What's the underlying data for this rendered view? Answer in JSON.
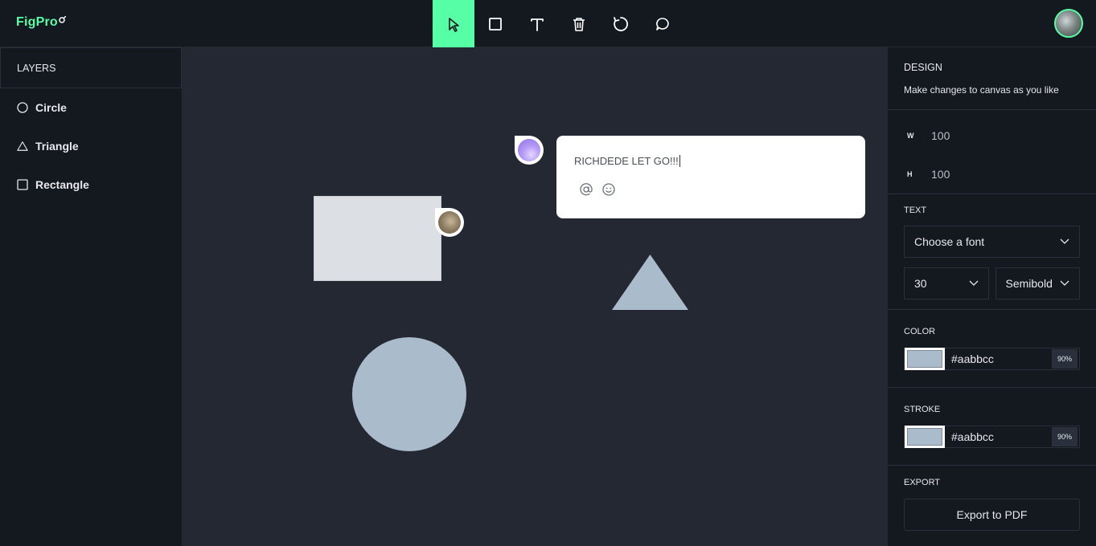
{
  "app": {
    "logo_text": "FigPro",
    "accent_color": "#56ffa6"
  },
  "toolbar": {
    "tools": [
      {
        "name": "select",
        "icon": "cursor-icon",
        "active": true
      },
      {
        "name": "rectangle",
        "icon": "square-icon"
      },
      {
        "name": "text",
        "icon": "text-icon"
      },
      {
        "name": "delete",
        "icon": "trash-icon"
      },
      {
        "name": "reset",
        "icon": "reset-icon"
      },
      {
        "name": "comment",
        "icon": "comment-icon"
      }
    ]
  },
  "layers": {
    "title": "LAYERS",
    "items": [
      {
        "label": "Circle",
        "icon": "circle-icon"
      },
      {
        "label": "Triangle",
        "icon": "triangle-icon"
      },
      {
        "label": "Rectangle",
        "icon": "square-icon"
      }
    ]
  },
  "canvas": {
    "comment": {
      "text": "RICHDEDE LET GO!!!"
    },
    "shape_fill": "#aabbcc",
    "rect_fill": "#dcdfe4"
  },
  "design": {
    "title": "DESIGN",
    "subtitle": "Make changes to canvas as you like",
    "width_label": "W",
    "width_value": "100",
    "height_label": "H",
    "height_value": "100"
  },
  "text": {
    "title": "TEXT",
    "font_placeholder": "Choose a font",
    "font_size": "30",
    "font_weight": "Semibold"
  },
  "color": {
    "title": "COLOR",
    "hex": "#aabbcc",
    "opacity": "90%"
  },
  "stroke": {
    "title": "STROKE",
    "hex": "#aabbcc",
    "opacity": "90%"
  },
  "export": {
    "title": "EXPORT",
    "button_label": "Export to PDF"
  }
}
